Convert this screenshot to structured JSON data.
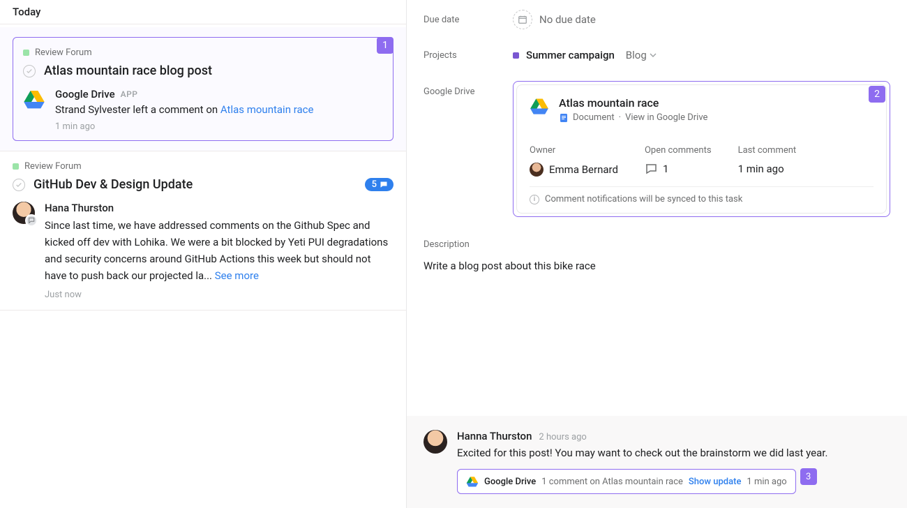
{
  "left": {
    "today": "Today",
    "item1": {
      "status": "Review Forum",
      "badge": "1",
      "title": "Atlas mountain race blog post",
      "actor": "Google Drive",
      "app_tag": "APP",
      "text_prefix": "Strand Sylvester left a comment on ",
      "link": "Atlas mountain race",
      "time": "1 min ago"
    },
    "item2": {
      "status": "Review Forum",
      "title": "GitHub Dev & Design Update",
      "comment_count": "5",
      "actor": "Hana Thurston",
      "body": "Since last time, we have addressed comments on the Github Spec and kicked off dev with Lohika. We were a bit blocked by Yeti PUI degradations and security concerns around GitHub Actions this week but should not have to push back our projected la... ",
      "see_more": "See more",
      "time": "Just now"
    }
  },
  "right": {
    "due_label": "Due date",
    "due_value": "No due date",
    "projects_label": "Projects",
    "project_name": "Summer campaign",
    "project_section": "Blog",
    "drive_label": "Google Drive",
    "drive_card": {
      "badge": "2",
      "title": "Atlas mountain race",
      "doc_type": "Document",
      "view_in": "View in Google Drive",
      "owner_label": "Owner",
      "owner_name": "Emma Bernard",
      "open_label": "Open comments",
      "open_count": "1",
      "last_label": "Last comment",
      "last_value": "1 min ago",
      "footer": "Comment notifications will be synced to this task"
    },
    "desc_label": "Description",
    "desc_text": "Write a blog post about this bike race",
    "comment": {
      "name": "Hanna Thurston",
      "time": "2 hours ago",
      "body": "Excited for this post! You may want to check out the brainstorm we did last year.",
      "update_app": "Google Drive",
      "update_text": "1 comment on Atlas mountain race",
      "update_show": "Show update",
      "update_time": "1 min ago",
      "update_badge": "3"
    }
  }
}
